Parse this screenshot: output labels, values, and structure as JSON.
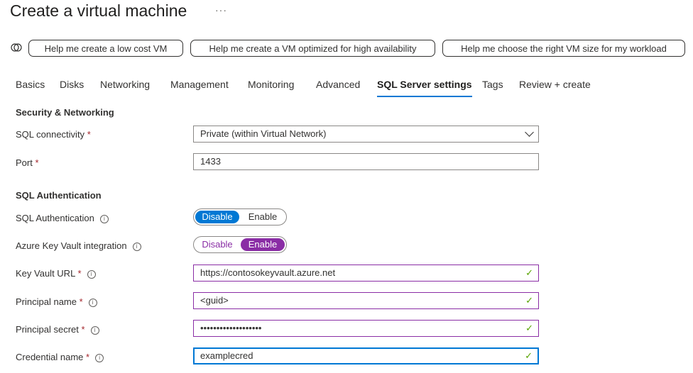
{
  "title": "Create a virtual machine",
  "more": "···",
  "assist_buttons": [
    "Help me create a low cost VM",
    "Help me create a VM optimized for high availability",
    "Help me choose the right VM size for my workload"
  ],
  "tabs": [
    "Basics",
    "Disks",
    "Networking",
    "Management",
    "Monitoring",
    "Advanced",
    "SQL Server settings",
    "Tags",
    "Review + create"
  ],
  "sections": {
    "security": "Security & Networking",
    "auth": "SQL Authentication"
  },
  "fields": {
    "connectivity": {
      "label": "SQL connectivity",
      "value": "Private (within Virtual Network)"
    },
    "port": {
      "label": "Port",
      "value": "1433"
    },
    "sql_auth": {
      "label": "SQL Authentication",
      "off": "Disable",
      "on": "Enable",
      "selected": "Disable"
    },
    "akv": {
      "label": "Azure Key Vault integration",
      "off": "Disable",
      "on": "Enable",
      "selected": "Enable"
    },
    "kv_url": {
      "label": "Key Vault URL",
      "value": "https://contosokeyvault.azure.net"
    },
    "principal": {
      "label": "Principal name",
      "value": "<guid>"
    },
    "secret": {
      "label": "Principal secret",
      "value": "•••••••••••••••••••"
    },
    "cred": {
      "label": "Credential name",
      "value": "examplecred"
    }
  },
  "req": "*",
  "info": "i",
  "check": "✓",
  "colors": {
    "accent": "#0078d4",
    "modified": "#8a2da5",
    "valid": "#57a300"
  }
}
